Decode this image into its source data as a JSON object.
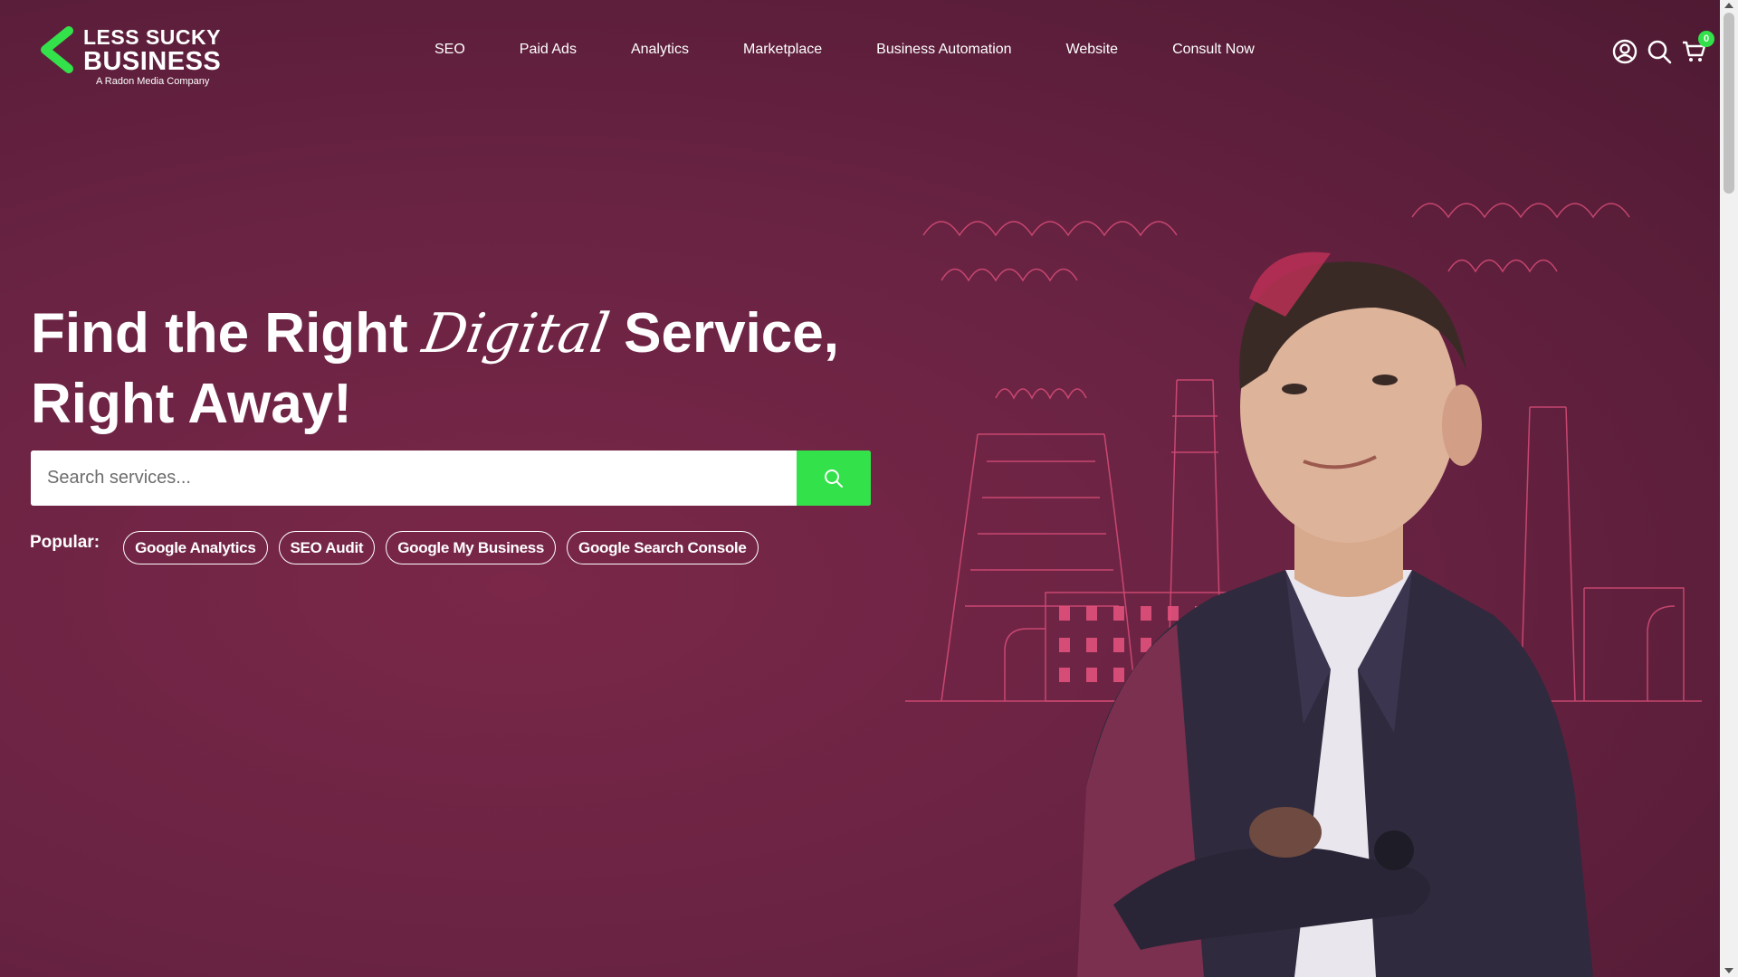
{
  "brand": {
    "line1": "LESS SUCKY",
    "line2": "BUSINESS",
    "tagline": "A Radon Media Company",
    "accent_color": "#33e14a",
    "background_color": "#6a2343"
  },
  "nav": {
    "items": [
      "SEO",
      "Paid Ads",
      "Analytics",
      "Marketplace",
      "Business Automation",
      "Website",
      "Consult Now"
    ]
  },
  "header_icons": {
    "account_icon": "user-circle-icon",
    "search_icon": "search-icon",
    "cart_icon": "cart-icon",
    "cart_count": "0"
  },
  "hero": {
    "title_part1": "Find the Right ",
    "title_script": "Digital",
    "title_part2": " Service,",
    "title_line2": "Right Away!"
  },
  "search": {
    "placeholder": "Search services...",
    "value": "",
    "button_icon": "search-icon"
  },
  "popular": {
    "label": "Popular:",
    "tags": [
      "Google Analytics",
      "SEO Audit",
      "Google My Business",
      "Google Search Console"
    ]
  }
}
